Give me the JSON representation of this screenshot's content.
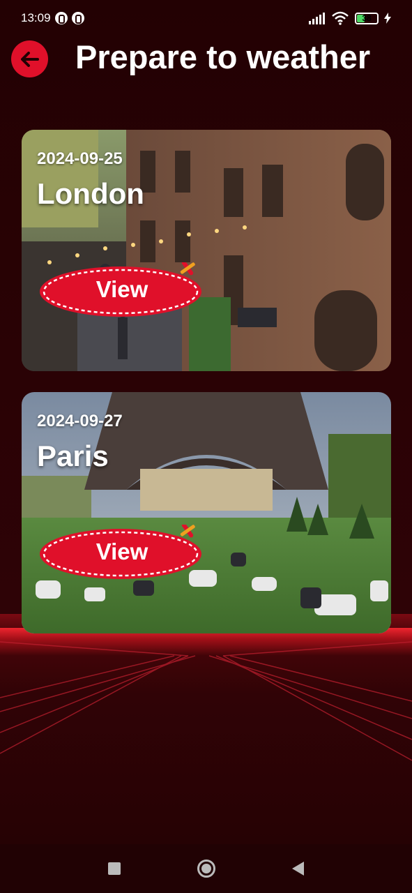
{
  "status_bar": {
    "time": "13:09",
    "battery_level": "38",
    "icons": [
      "notification-icon",
      "notification-icon",
      "signal-icon",
      "wifi-icon",
      "battery-icon",
      "charging-icon"
    ]
  },
  "header": {
    "title": "Prepare to weather",
    "back_icon": "arrow-left-icon"
  },
  "trips": [
    {
      "date": "2024-09-25",
      "city": "London",
      "button_label": "View"
    },
    {
      "date": "2024-09-27",
      "city": "Paris",
      "button_label": "View"
    }
  ],
  "nav_bar": {
    "icons": [
      "recent-apps-icon",
      "home-icon",
      "back-icon"
    ]
  },
  "colors": {
    "accent": "#e0102a",
    "background": "#250204"
  }
}
